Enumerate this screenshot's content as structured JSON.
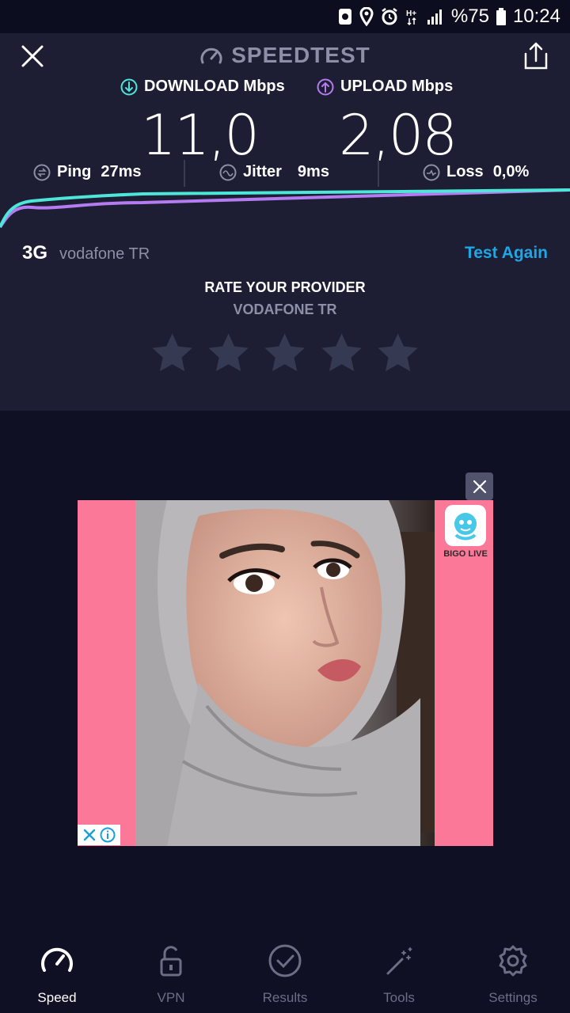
{
  "status_bar": {
    "battery": "%75",
    "time": "10:24"
  },
  "header": {
    "title": "SPEEDTEST"
  },
  "metrics": {
    "download_label": "DOWNLOAD Mbps",
    "upload_label": "UPLOAD Mbps",
    "download_value": "11,0",
    "upload_value": "2,08"
  },
  "stats": {
    "ping_label": "Ping",
    "ping_value": "27ms",
    "jitter_label": "Jitter",
    "jitter_value": "9ms",
    "loss_label": "Loss",
    "loss_value": "0,0%"
  },
  "network": {
    "type": "3G",
    "name": "vodafone TR",
    "test_again": "Test Again"
  },
  "rating": {
    "title": "RATE YOUR PROVIDER",
    "provider": "VODAFONE TR",
    "stars": 5,
    "selected": 0
  },
  "ad": {
    "brand": "BIGO LIVE"
  },
  "nav": [
    {
      "label": "Speed",
      "icon": "speed-gauge-icon",
      "active": true
    },
    {
      "label": "VPN",
      "icon": "lock-icon",
      "active": false
    },
    {
      "label": "Results",
      "icon": "checkmark-circle-icon",
      "active": false
    },
    {
      "label": "Tools",
      "icon": "magic-wand-icon",
      "active": false
    },
    {
      "label": "Settings",
      "icon": "gear-icon",
      "active": false
    }
  ],
  "colors": {
    "download": "#4de6d9",
    "upload": "#b47cf0",
    "accent": "#1ea7e6"
  }
}
